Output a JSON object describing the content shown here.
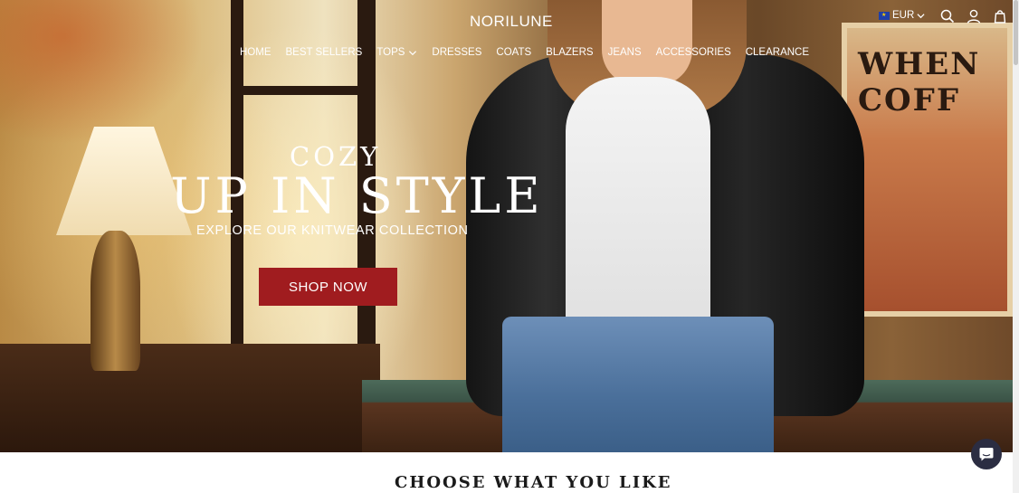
{
  "header": {
    "brand": "NORILUNE",
    "currency": "EUR",
    "icons": [
      "eu-flag-icon",
      "chevron-down-icon",
      "search-icon",
      "account-icon",
      "cart-bag-icon"
    ]
  },
  "nav": {
    "items": [
      {
        "label": "HOME"
      },
      {
        "label": "BEST SELLERS"
      },
      {
        "label": "TOPS",
        "has_dropdown": true
      },
      {
        "label": "DRESSES"
      },
      {
        "label": "COATS"
      },
      {
        "label": "BLAZERS"
      },
      {
        "label": "JEANS"
      },
      {
        "label": "ACCESSORIES"
      },
      {
        "label": "CLEARANCE"
      }
    ]
  },
  "hero": {
    "line1": "COZY",
    "line2": "UP IN STYLE",
    "subtitle": "EXPLORE OUR KNITWEAR COLLECTION",
    "cta": "SHOP NOW",
    "cta_color": "#a01c1f"
  },
  "section": {
    "title": "CHOOSE WHAT YOU LIKE"
  },
  "chat": {
    "icon": "chat-bubble-icon",
    "color": "#2b2d42"
  }
}
